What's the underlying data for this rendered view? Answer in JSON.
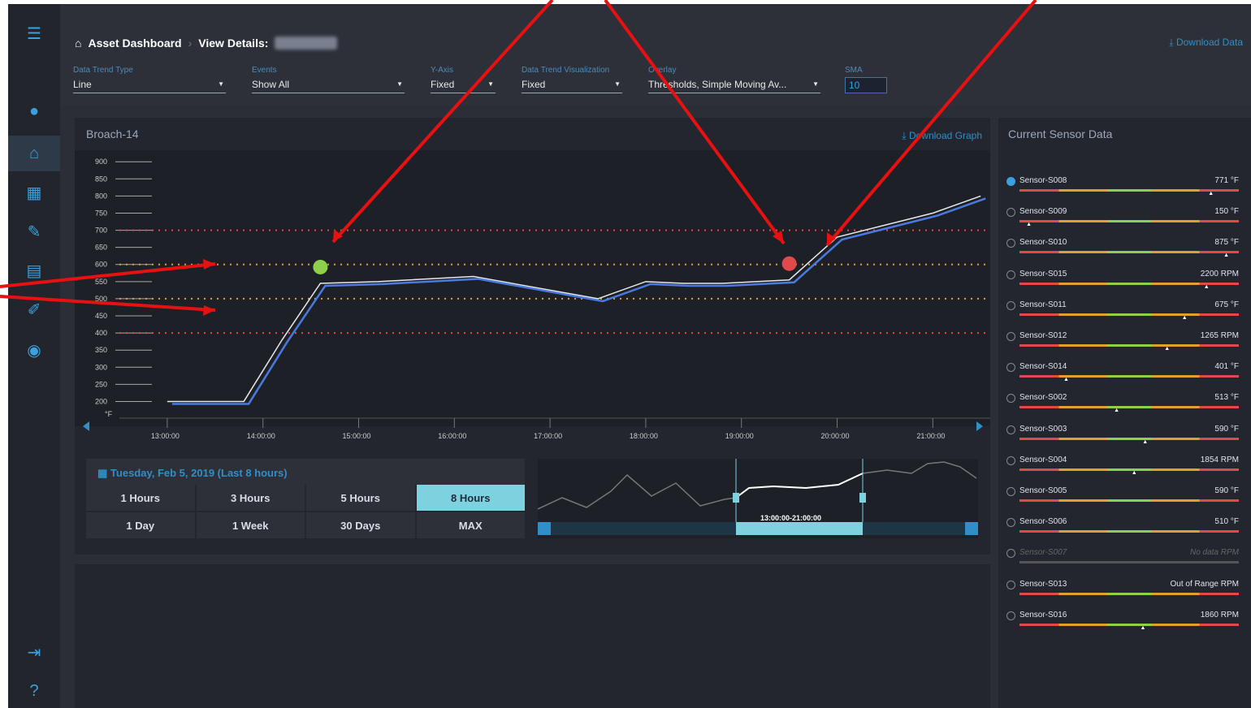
{
  "header": {
    "breadcrumb_home": "Asset Dashboard",
    "breadcrumb_detail": "View Details:",
    "breadcrumb_asset": "Broach-14",
    "download_data": "Download Data"
  },
  "filters": {
    "trend_type": {
      "label": "Data Trend Type",
      "value": "Line"
    },
    "events": {
      "label": "Events",
      "value": "Show All"
    },
    "y_axis": {
      "label": "Y-Axis",
      "value": "Fixed"
    },
    "visualization": {
      "label": "Data Trend Visualization",
      "value": "Fixed"
    },
    "overlay": {
      "label": "Overlay",
      "value": "Thresholds, Simple Moving Av..."
    },
    "sma": {
      "label": "SMA",
      "value": "10"
    }
  },
  "chart_card": {
    "title": "Broach-14",
    "download_graph": "Download Graph"
  },
  "chart_data": {
    "type": "line",
    "ylabel_unit": "°F",
    "ylim": [
      175,
      910
    ],
    "yticks": [
      200,
      250,
      300,
      350,
      400,
      450,
      500,
      550,
      600,
      650,
      700,
      750,
      800,
      850,
      900
    ],
    "xticks": [
      "13:00:00",
      "14:00:00",
      "15:00:00",
      "16:00:00",
      "17:00:00",
      "18:00:00",
      "19:00:00",
      "20:00:00",
      "21:00:00"
    ],
    "series": [
      {
        "values_x": [
          13.0,
          13.8,
          14.2,
          14.6,
          15.2,
          16.2,
          17.5,
          18.0,
          18.4,
          18.8,
          19.5,
          20.0,
          21.0,
          21.5
        ],
        "values_y": [
          200,
          200,
          380,
          545,
          550,
          565,
          500,
          550,
          545,
          545,
          555,
          680,
          750,
          800
        ]
      }
    ],
    "thresholds": [
      {
        "value": 700,
        "color": "#e14a4a"
      },
      {
        "value": 400,
        "color": "#e14a4a"
      },
      {
        "value": 600,
        "color": "#e0a030"
      },
      {
        "value": 500,
        "color": "#e0a030"
      }
    ],
    "events": [
      {
        "type": "ok",
        "color": "#8ed04a"
      },
      {
        "type": "alert",
        "color": "#e14a4a"
      }
    ]
  },
  "time_panel": {
    "date_label": "Tuesday, Feb 5, 2019 (Last 8 hours)",
    "buttons": [
      "1 Hours",
      "3 Hours",
      "5 Hours",
      "8 Hours",
      "1 Day",
      "1 Week",
      "30 Days",
      "MAX"
    ],
    "selected": "8 Hours",
    "range_label": "13:00:00-21:00:00"
  },
  "sensors": {
    "title": "Current Sensor Data",
    "items": [
      {
        "name": "Sensor-S008",
        "value": "771 °F",
        "selected": true,
        "pos": 0.86
      },
      {
        "name": "Sensor-S009",
        "value": "150 °F",
        "selected": false,
        "pos": 0.03
      },
      {
        "name": "Sensor-S010",
        "value": "875 °F",
        "selected": false,
        "pos": 0.93
      },
      {
        "name": "Sensor-S015",
        "value": "2200 RPM",
        "selected": false,
        "pos": 0.84
      },
      {
        "name": "Sensor-S011",
        "value": "675 °F",
        "selected": false,
        "pos": 0.74
      },
      {
        "name": "Sensor-S012",
        "value": "1265 RPM",
        "selected": false,
        "pos": 0.66
      },
      {
        "name": "Sensor-S014",
        "value": "401 °F",
        "selected": false,
        "pos": 0.2
      },
      {
        "name": "Sensor-S002",
        "value": "513 °F",
        "selected": false,
        "pos": 0.43
      },
      {
        "name": "Sensor-S003",
        "value": "590 °F",
        "selected": false,
        "pos": 0.56
      },
      {
        "name": "Sensor-S004",
        "value": "1854 RPM",
        "selected": false,
        "pos": 0.51
      },
      {
        "name": "Sensor-S005",
        "value": "590 °F",
        "selected": false,
        "pos": -1
      },
      {
        "name": "Sensor-S006",
        "value": "510 °F",
        "selected": false,
        "pos": -1
      },
      {
        "name": "Sensor-S007",
        "value": "No data RPM",
        "selected": false,
        "pos": -1,
        "dim": true
      },
      {
        "name": "Sensor-S013",
        "value": "Out of Range RPM",
        "selected": false,
        "pos": -1
      },
      {
        "name": "Sensor-S016",
        "value": "1860 RPM",
        "selected": false,
        "pos": 0.55
      }
    ]
  }
}
